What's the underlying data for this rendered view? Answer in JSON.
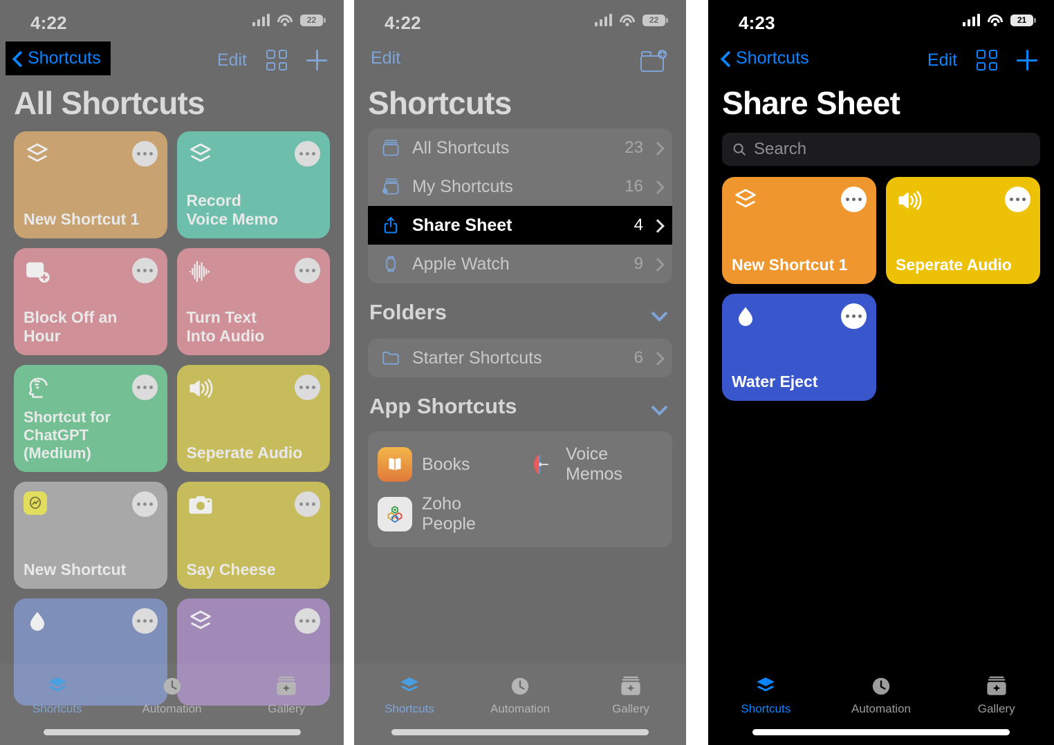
{
  "panels": {
    "all_shortcuts": {
      "status": {
        "time": "4:22",
        "battery": "22",
        "signal_icon": "cellular-bars-icon",
        "wifi_icon": "wifi-icon",
        "battery_icon": "battery-icon"
      },
      "nav": {
        "back_label": "Shortcuts",
        "back_icon": "chevron-left-icon",
        "edit_label": "Edit",
        "grid_icon": "grid-view-icon",
        "plus_icon": "plus-icon"
      },
      "title": "All Shortcuts",
      "tiles": [
        {
          "label": "New Shortcut 1",
          "icon": "layers-icon",
          "color": "#c9a272"
        },
        {
          "label": "Record\nVoice Memo",
          "icon": "layers-icon",
          "color": "#6dbfab"
        },
        {
          "label": "Block Off an Hour",
          "icon": "calendar-plus-icon",
          "color": "#cf9098"
        },
        {
          "label": "Turn Text\nInto Audio",
          "icon": "waveform-icon",
          "color": "#cf9098"
        },
        {
          "label": "Shortcut for\nChatGPT\n(Medium)",
          "icon": "brain-head-icon",
          "color": "#74bf94"
        },
        {
          "label": "Seperate Audio",
          "icon": "speaker-wave-icon",
          "color": "#c7bc5c"
        },
        {
          "label": "New Shortcut",
          "icon": "zoho-app-icon",
          "color": "#a8a8a8"
        },
        {
          "label": "Say Cheese",
          "icon": "camera-icon",
          "color": "#c7bc5c"
        },
        {
          "label": "",
          "icon": "water-drop-icon",
          "color": "#7e8fba"
        },
        {
          "label": "",
          "icon": "layers-icon",
          "color": "#a18ab8"
        }
      ],
      "tabs": [
        {
          "label": "Shortcuts",
          "icon": "layers-icon",
          "active": true
        },
        {
          "label": "Automation",
          "icon": "clock-icon",
          "active": false
        },
        {
          "label": "Gallery",
          "icon": "gallery-sparkle-icon",
          "active": false
        }
      ]
    },
    "shortcuts_list": {
      "status": {
        "time": "4:22",
        "battery": "22",
        "signal_icon": "cellular-bars-icon",
        "wifi_icon": "wifi-icon",
        "battery_icon": "battery-icon"
      },
      "nav": {
        "edit_label": "Edit",
        "new_folder_icon": "folder-plus-icon"
      },
      "title": "Shortcuts",
      "rows": [
        {
          "label": "All Shortcuts",
          "count": "23",
          "icon": "all-shortcuts-icon",
          "selected": false
        },
        {
          "label": "My Shortcuts",
          "count": "16",
          "icon": "my-shortcuts-icon",
          "selected": false
        },
        {
          "label": "Share Sheet",
          "count": "4",
          "icon": "share-icon",
          "selected": true
        },
        {
          "label": "Apple Watch",
          "count": "9",
          "icon": "apple-watch-icon",
          "selected": false
        }
      ],
      "folders_section": {
        "title": "Folders",
        "chevron_icon": "chevron-down-icon"
      },
      "folders": [
        {
          "label": "Starter Shortcuts",
          "count": "6",
          "icon": "folder-icon",
          "selected": false
        }
      ],
      "app_section": {
        "title": "App Shortcuts",
        "chevron_icon": "chevron-down-icon"
      },
      "apps": [
        {
          "name": "Books",
          "icon": "books-app-icon"
        },
        {
          "name": "Voice\nMemos",
          "icon": "voice-memos-app-icon"
        },
        {
          "name": "Zoho\nPeople",
          "icon": "zoho-people-app-icon"
        }
      ],
      "tabs": [
        {
          "label": "Shortcuts",
          "icon": "layers-icon",
          "active": true
        },
        {
          "label": "Automation",
          "icon": "clock-icon",
          "active": false
        },
        {
          "label": "Gallery",
          "icon": "gallery-sparkle-icon",
          "active": false
        }
      ]
    },
    "share_sheet": {
      "status": {
        "time": "4:23",
        "battery": "21",
        "signal_icon": "cellular-bars-icon",
        "wifi_icon": "wifi-icon",
        "battery_icon": "battery-icon"
      },
      "nav": {
        "back_label": "Shortcuts",
        "back_icon": "chevron-left-icon",
        "edit_label": "Edit",
        "grid_icon": "grid-view-icon",
        "plus_icon": "plus-icon"
      },
      "title": "Share Sheet",
      "search": {
        "placeholder": "Search",
        "value": "",
        "icon": "magnifier-icon"
      },
      "tiles": [
        {
          "label": "New Shortcut 1",
          "icon": "layers-icon",
          "color": "#f0962e"
        },
        {
          "label": "Seperate Audio",
          "icon": "speaker-wave-icon",
          "color": "#edc206"
        },
        {
          "label": "Water Eject",
          "icon": "water-drop-icon",
          "color": "#3a56cc"
        }
      ],
      "tabs": [
        {
          "label": "Shortcuts",
          "icon": "layers-icon",
          "active": true
        },
        {
          "label": "Automation",
          "icon": "clock-icon",
          "active": false
        },
        {
          "label": "Gallery",
          "icon": "gallery-sparkle-icon",
          "active": false
        }
      ]
    }
  }
}
